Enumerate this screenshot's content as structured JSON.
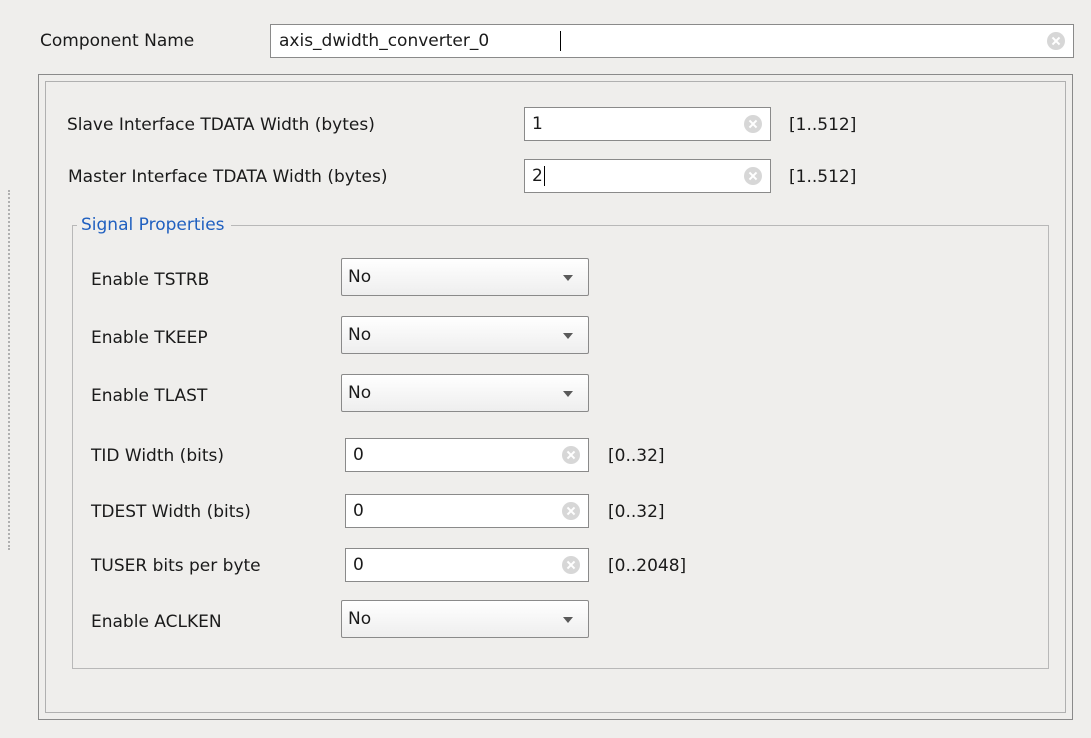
{
  "component": {
    "label": "Component Name",
    "value": "axis_dwidth_converter_0"
  },
  "widths": [
    {
      "label": "Slave Interface TDATA Width (bytes)",
      "value": "1",
      "range": "[1..512]"
    },
    {
      "label": "Master Interface TDATA Width (bytes)",
      "value": "2",
      "range": "[1..512]"
    }
  ],
  "signal_properties": {
    "title": "Signal Properties",
    "enable_tstrb": {
      "label": "Enable TSTRB",
      "value": "No"
    },
    "enable_tkeep": {
      "label": "Enable TKEEP",
      "value": "No"
    },
    "enable_tlast": {
      "label": "Enable TLAST",
      "value": "No"
    },
    "tid_width": {
      "label": "TID Width (bits)",
      "value": "0",
      "range": "[0..32]"
    },
    "tdest_width": {
      "label": "TDEST Width (bits)",
      "value": "0",
      "range": "[0..32]"
    },
    "tuser_bits": {
      "label": "TUSER bits per byte",
      "value": "0",
      "range": "[0..2048]"
    },
    "enable_aclken": {
      "label": "Enable ACLKEN",
      "value": "No"
    }
  }
}
